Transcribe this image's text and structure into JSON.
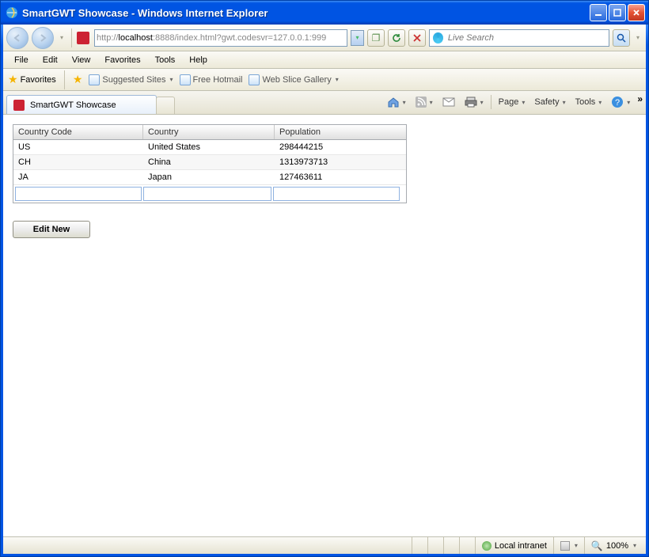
{
  "window": {
    "title": "SmartGWT Showcase - Windows Internet Explorer"
  },
  "address": {
    "prefix": "http://",
    "host": "localhost",
    "rest": ":8888/index.html?gwt.codesvr=127.0.0.1:999"
  },
  "search": {
    "placeholder": "Live Search"
  },
  "menu": {
    "file": "File",
    "edit": "Edit",
    "view": "View",
    "favorites": "Favorites",
    "tools": "Tools",
    "help": "Help"
  },
  "favbar": {
    "favorites": "Favorites",
    "suggested": "Suggested Sites",
    "hotmail": "Free Hotmail",
    "webslice": "Web Slice Gallery"
  },
  "tab": {
    "title": "SmartGWT Showcase"
  },
  "cmd": {
    "page": "Page",
    "safety": "Safety",
    "tools": "Tools"
  },
  "grid": {
    "headers": {
      "code": "Country Code",
      "country": "Country",
      "pop": "Population"
    },
    "rows": [
      {
        "code": "US",
        "country": "United States",
        "pop": "298444215"
      },
      {
        "code": "CH",
        "country": "China",
        "pop": "1313973713"
      },
      {
        "code": "JA",
        "country": "Japan",
        "pop": "127463611"
      }
    ]
  },
  "buttons": {
    "editNew": "Edit New"
  },
  "status": {
    "zone": "Local intranet",
    "zoom": "100%"
  }
}
